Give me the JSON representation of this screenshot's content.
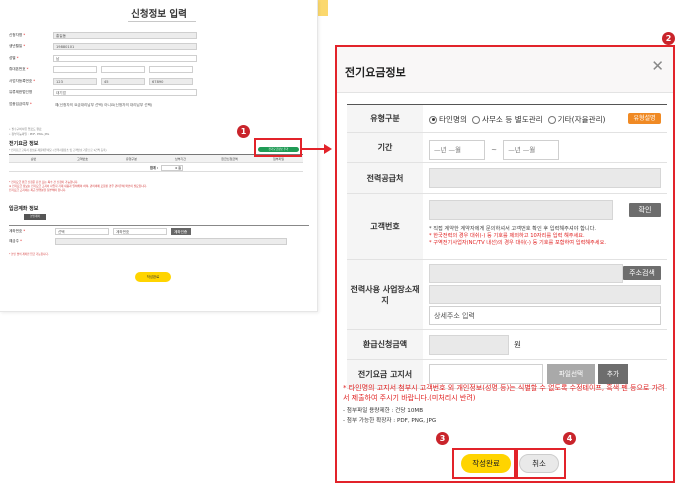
{
  "background": {
    "title": "신청정보 입력",
    "fields": [
      {
        "label": "신청자명",
        "required": true,
        "value": "홍길동"
      },
      {
        "label": "생년월일",
        "required": true,
        "value": "19880101"
      },
      {
        "label": "성별",
        "required": true,
        "value": "남"
      },
      {
        "label": "휴대폰번호",
        "required": true,
        "value": ""
      },
      {
        "label": "사업자등록번호",
        "required": true,
        "values": [
          "123",
          "45",
          "67890"
        ]
      },
      {
        "label": "유류제한법인명",
        "required": false,
        "value": "대기업"
      },
      {
        "label": "업종입금여부",
        "required": true,
        "value": "예(신청자의 요금대리납부 선택)   아니요(신청자의 대리납부 선택)"
      }
    ],
    "notes": [
      "• 필수구비서류 업로드 완료",
      "• 첨부가능파일 : PDF, PNG, JPG"
    ],
    "section_elec_title": "전기요금 정보",
    "section_elec_sub": "* 전기요금 고지서 정보를 제출해주세요. (전력사용장소 및 고객번호 기준으로 1건씩 등록)",
    "elec_add_button": "전기요금정보 추가",
    "table_headers": [
      "순번",
      "고객번호",
      "유형구분",
      "납부기간",
      "환급신청금액",
      "첨부파일"
    ],
    "total_label": "합계 :",
    "total_value": "0 원",
    "red_notes": [
      "* 전기요금 환급 신청은 단건 또는 복수 건 신청이 가능합니다.",
      "※ 전기요금 정보는 전기요금 고지서 사업자 기재 내용과 일치해야 하며, 관리비에 포함된 경우 관리주체 확인이 필요합니다.",
      "   전기요금 고지서는 최근 발행분을 첨부해야 합니다."
    ],
    "section_acct_title": "입금계좌 정보",
    "acct_button": "본인계좌",
    "acct_fields": [
      {
        "label": "계좌번호",
        "required": true,
        "bank": "선택",
        "placeholder": "계좌번호",
        "button": "계좌인증"
      },
      {
        "label": "예금주",
        "required": true,
        "value": ""
      }
    ],
    "acct_note": "* 본인 명의 계좌만 입금 가능합니다.",
    "submit_label": "작성완료"
  },
  "modal": {
    "title": "전기요금정보",
    "close_glyph": "✕",
    "rows": {
      "type": {
        "label": "유형구분",
        "options": [
          "타인명의",
          "사무소 등 별도관리",
          "기타(자율관리)"
        ],
        "selected": "타인명의",
        "help_button": "유형설명"
      },
      "period": {
        "label": "기간",
        "from_placeholder": "—년 —월",
        "to_placeholder": "—년 —월",
        "separator": "~"
      },
      "supplier": {
        "label": "전력공급처"
      },
      "customer": {
        "label": "고객번호",
        "confirm_button": "확인",
        "hint": "* 직접 계약한 계약자에게 문의하셔서 고객번호 확인 후 입력해주셔야 합니다.",
        "red_hint_1": "* 한국전력의 경우 대쉬(-) 등 기호를 제외하고 10자리를 입력 해주세요.",
        "red_hint_2": "* 구역전기사업자(NC/TV 내선)의 경우 대쉬(-) 등 기호를 포함하여 입력해주세요."
      },
      "address": {
        "label": "전력사용 사업장소재지",
        "search_button": "주소검색",
        "detail_placeholder": "상세주소 입력"
      },
      "refund": {
        "label": "환급신청금액",
        "unit": "원"
      },
      "bill": {
        "label": "전기요금 고지서",
        "file_button": "파일선택",
        "add_button": "추가"
      }
    },
    "warning": "* 타인명의 고지서 첨부시 고객번호 외 개인정보(성명 등)는 식별할 수 없도록 수정테이프, 흑색 펜 등으로 가려서 제출하여 주시기 바랍니다.(미처리시 반려)",
    "file_notes": [
      "- 첨부파일 용량제한 : 건당 10MB",
      "- 첨부 가능한 확장자 : PDF, PNG, JPG"
    ],
    "confirm_label": "작성완료",
    "cancel_label": "취소"
  },
  "callouts": [
    "1",
    "2",
    "3",
    "4"
  ],
  "colors": {
    "accent_red": "#e2232a",
    "badge": "#c9242b",
    "yellow": "#ffd400",
    "orange": "#f08a24",
    "green": "#1f9b55"
  }
}
